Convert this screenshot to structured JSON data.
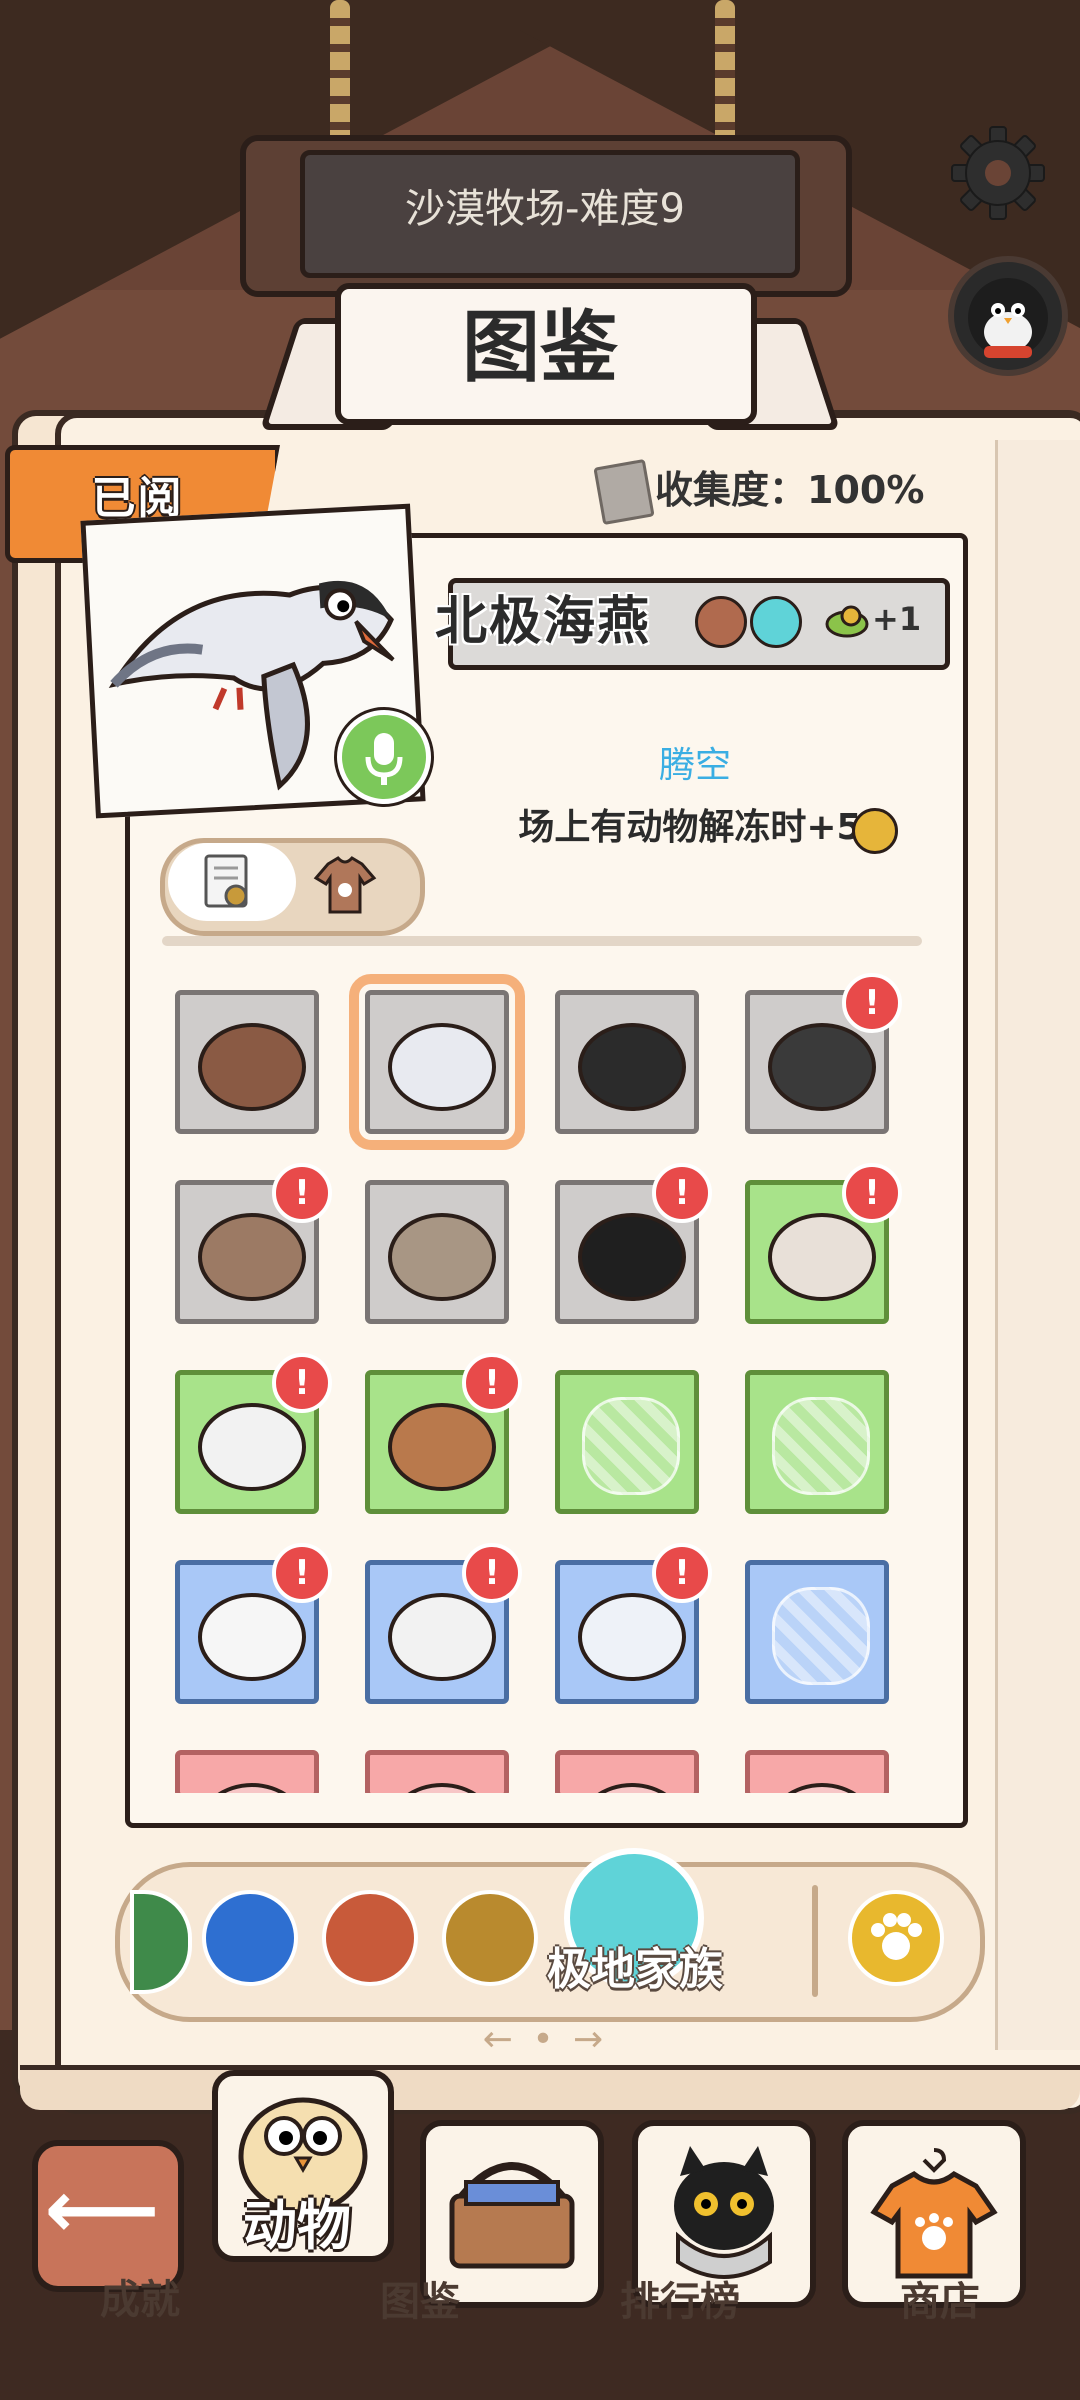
{
  "header": {
    "level_title": "沙漠牧场-难度9",
    "settings_icon": "gear-icon",
    "avatar_icon": "penguin-avatar"
  },
  "title": "图鉴",
  "read_tab": "已阅",
  "collection": {
    "label": "收集度：100%"
  },
  "detail": {
    "name": "北极海燕",
    "bonus": "+1",
    "skill_name": "腾空",
    "skill_desc": "场上有动物解冻时+5",
    "tags": [
      "bird-tag-icon",
      "cloud-tag-icon",
      "food-plus-icon"
    ]
  },
  "grid": [
    {
      "kind": "gray",
      "icon": "capybara-icon",
      "alert": false,
      "selected": false
    },
    {
      "kind": "gray",
      "icon": "petrel-icon",
      "alert": false,
      "selected": true
    },
    {
      "kind": "gray",
      "icon": "duck-icon",
      "alert": false,
      "selected": false
    },
    {
      "kind": "gray",
      "icon": "badger-icon",
      "alert": true,
      "selected": false
    },
    {
      "kind": "gray",
      "icon": "walrus-icon",
      "alert": true,
      "selected": false
    },
    {
      "kind": "gray",
      "icon": "seal-icon",
      "alert": false,
      "selected": false
    },
    {
      "kind": "gray",
      "icon": "black-sheep-icon",
      "alert": true,
      "selected": false
    },
    {
      "kind": "green",
      "icon": "pony-icon",
      "alert": true,
      "selected": false
    },
    {
      "kind": "green",
      "icon": "guinea-pig-icon",
      "alert": true,
      "selected": false
    },
    {
      "kind": "green",
      "icon": "snake-icon",
      "alert": true,
      "selected": false
    },
    {
      "kind": "green",
      "icon": "locked-bird-silhouette",
      "alert": false,
      "selected": false
    },
    {
      "kind": "green",
      "icon": "locked-cactus-silhouette",
      "alert": false,
      "selected": false
    },
    {
      "kind": "blue",
      "icon": "penguin-icon",
      "alert": true,
      "selected": false
    },
    {
      "kind": "blue",
      "icon": "snowy-owl-icon",
      "alert": true,
      "selected": false
    },
    {
      "kind": "blue",
      "icon": "arctic-hare-icon",
      "alert": true,
      "selected": false
    },
    {
      "kind": "blue",
      "icon": "locked-animal-silhouette",
      "alert": false,
      "selected": false
    },
    {
      "kind": "pink",
      "icon": "pink-animal-icon",
      "alert": false,
      "selected": false
    },
    {
      "kind": "pink",
      "icon": "pink-animal-icon",
      "alert": false,
      "selected": false
    },
    {
      "kind": "pink",
      "icon": "pink-animal-icon",
      "alert": false,
      "selected": false
    },
    {
      "kind": "pink",
      "icon": "pink-animal-icon",
      "alert": false,
      "selected": false
    }
  ],
  "family_bar": {
    "label": "极地家族",
    "items": [
      "partial-family-icon",
      "blue-fish-family-icon",
      "red-sack-family-icon",
      "gold-skull-family-icon",
      "teal-family-icon",
      "paw-family-icon"
    ],
    "pager": "← • →"
  },
  "nav": {
    "back_glyph": "⟵",
    "items": [
      {
        "label": "动物",
        "icon": "chick-icon",
        "active": true
      },
      {
        "label": "成就",
        "icon": "",
        "active": false
      },
      {
        "label": "图鉴",
        "icon": "basket-icon",
        "active": false
      },
      {
        "label": "排行榜",
        "icon": "black-cat-icon",
        "active": false
      },
      {
        "label": "商店",
        "icon": "shirt-icon",
        "active": false
      }
    ]
  },
  "colors": {
    "accent_orange": "#f08a35",
    "skill_blue": "#3aaee3",
    "alert_red": "#e84a4a",
    "green_cell": "#a8e38a",
    "blue_cell": "#a9c8f7",
    "pink_cell": "#f7a8a8"
  }
}
